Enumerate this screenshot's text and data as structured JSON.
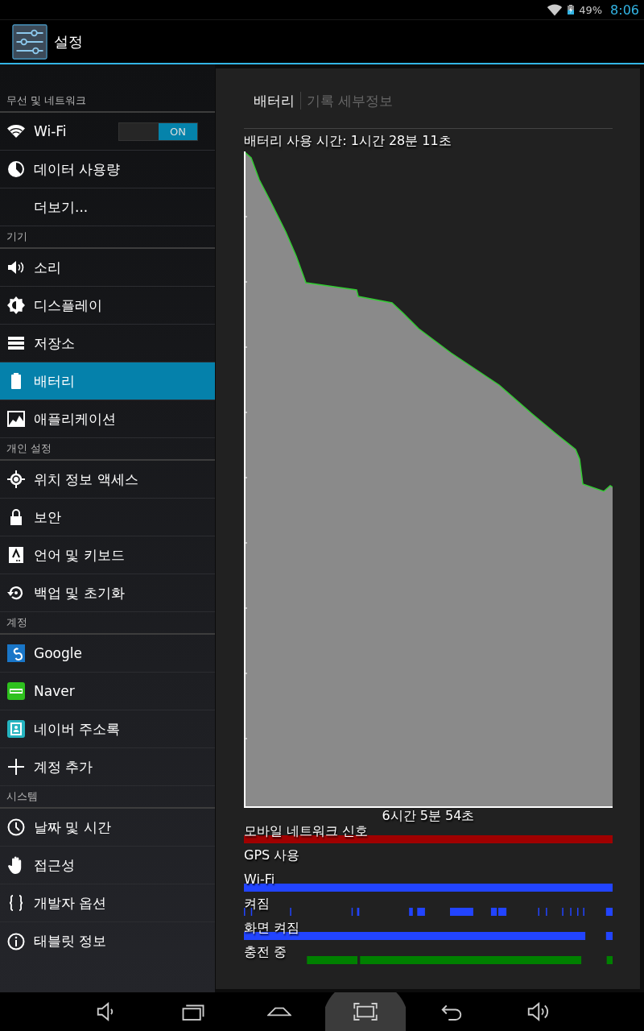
{
  "status_bar": {
    "battery": "49%",
    "time": "8:06"
  },
  "action_bar": {
    "title": "설정"
  },
  "sidebar": {
    "sections": [
      {
        "header": "무선 및 네트워크",
        "items": [
          {
            "label": "Wi-Fi",
            "kind": "toggle",
            "toggle": {
              "label": "ON",
              "on": true
            },
            "selected": false
          },
          {
            "label": "데이터 사용량",
            "kind": "link",
            "selected": false
          },
          {
            "label": "더보기...",
            "kind": "link",
            "selected": false
          }
        ]
      },
      {
        "header": "기기",
        "items": [
          {
            "label": "소리",
            "kind": "link",
            "selected": false
          },
          {
            "label": "디스플레이",
            "kind": "link",
            "selected": false
          },
          {
            "label": "저장소",
            "kind": "link",
            "selected": false
          },
          {
            "label": "배터리",
            "kind": "link",
            "selected": true
          },
          {
            "label": "애플리케이션",
            "kind": "link",
            "selected": false
          }
        ]
      },
      {
        "header": "개인 설정",
        "items": [
          {
            "label": "위치 정보 액세스",
            "kind": "link",
            "selected": false
          },
          {
            "label": "보안",
            "kind": "link",
            "selected": false
          },
          {
            "label": "언어 및 키보드",
            "kind": "link",
            "selected": false
          },
          {
            "label": "백업 및 초기화",
            "kind": "link",
            "selected": false
          }
        ]
      },
      {
        "header": "계정",
        "items": [
          {
            "label": "Google",
            "kind": "link",
            "selected": false
          },
          {
            "label": "Naver",
            "kind": "link",
            "selected": false
          },
          {
            "label": "네이버 주소록",
            "kind": "link",
            "selected": false
          },
          {
            "label": "계정 추가",
            "kind": "link",
            "selected": false
          }
        ]
      },
      {
        "header": "시스템",
        "items": [
          {
            "label": "날짜 및 시간",
            "kind": "link",
            "selected": false
          },
          {
            "label": "접근성",
            "kind": "link",
            "selected": false
          },
          {
            "label": "개발자 옵션",
            "kind": "link",
            "selected": false
          },
          {
            "label": "태블릿 정보",
            "kind": "link",
            "selected": false
          }
        ]
      }
    ]
  },
  "panel": {
    "tabs": [
      {
        "label": "배터리",
        "selected": true
      },
      {
        "label": "기록 세부정보",
        "selected": false
      }
    ],
    "usage_time": "배터리 사용 시간: 1시간 28분 11초",
    "graph_duration": "6시간 5분 54초",
    "tracks": [
      {
        "label": "모바일 네트워크 신호",
        "color": "#a00000"
      },
      {
        "label": "GPS 사용"
      },
      {
        "label": "Wi-Fi",
        "color": "#2244ff"
      },
      {
        "label": "켜짐",
        "color": "#2244ff"
      },
      {
        "label": "화면 켜짐",
        "color": "#2244ff"
      },
      {
        "label": "충전 중",
        "color": "#008000"
      }
    ]
  }
}
